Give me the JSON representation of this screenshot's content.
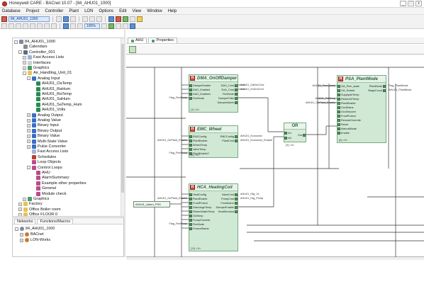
{
  "window": {
    "title": "Honeywell CARE - BACnet 10.07 - [84_AHU01_1000]",
    "controls": [
      "_",
      "□",
      "x"
    ]
  },
  "menu": [
    "Database",
    "Project",
    "Controller",
    "Plant",
    "LON",
    "Options",
    "Edit",
    "View",
    "Window",
    "Help"
  ],
  "toolbar": {
    "project_combo": "84_AHU01_1000",
    "zoom_combo": "100%"
  },
  "tree": {
    "nodes": [
      {
        "label": "84_AHU01_1000",
        "indent": 0,
        "toggle": "-",
        "icon": "building-icon"
      },
      {
        "label": "Calendars",
        "indent": 1,
        "toggle": "",
        "icon": "calendar-icon"
      },
      {
        "label": "Controller_001",
        "indent": 1,
        "toggle": "-",
        "icon": "controller-icon"
      },
      {
        "label": "Fast Access Lists",
        "indent": 2,
        "toggle": "+",
        "icon": "fast-access-icon"
      },
      {
        "label": "Interfaces",
        "indent": 2,
        "toggle": "+",
        "icon": "interface-icon"
      },
      {
        "label": "Graphics",
        "indent": 2,
        "toggle": "+",
        "icon": "graphics-icon"
      },
      {
        "label": "Air_Handling_Unit_01",
        "indent": 2,
        "toggle": "-",
        "icon": "folder-icon"
      },
      {
        "label": "Analog Input",
        "indent": 3,
        "toggle": "-",
        "icon": "point-icon"
      },
      {
        "label": "AHU01_OaTemp",
        "indent": 4,
        "toggle": "",
        "icon": "datapoint-icon"
      },
      {
        "label": "AHU01_RaHum",
        "indent": 4,
        "toggle": "",
        "icon": "datapoint-icon"
      },
      {
        "label": "AHU01_RaTemp",
        "indent": 4,
        "toggle": "",
        "icon": "datapoint-icon"
      },
      {
        "label": "AHU01_SaHum",
        "indent": 4,
        "toggle": "",
        "icon": "datapoint-icon"
      },
      {
        "label": "AHU01_SaTemp_Hum",
        "indent": 4,
        "toggle": "",
        "icon": "datapoint-icon"
      },
      {
        "label": "AHU01_Volts",
        "indent": 4,
        "toggle": "",
        "icon": "datapoint-icon"
      },
      {
        "label": "Analog Output",
        "indent": 3,
        "toggle": "+",
        "icon": "point-icon"
      },
      {
        "label": "Analog Value",
        "indent": 3,
        "toggle": "+",
        "icon": "point-icon"
      },
      {
        "label": "Binary Input",
        "indent": 3,
        "toggle": "+",
        "icon": "point-icon"
      },
      {
        "label": "Binary Output",
        "indent": 3,
        "toggle": "+",
        "icon": "point-icon"
      },
      {
        "label": "Binary Value",
        "indent": 3,
        "toggle": "+",
        "icon": "point-icon"
      },
      {
        "label": "Multi-State Value",
        "indent": 3,
        "toggle": "+",
        "icon": "point-icon"
      },
      {
        "label": "Pulse Converter",
        "indent": 3,
        "toggle": "+",
        "icon": "point-icon"
      },
      {
        "label": "Fast Access Lists",
        "indent": 3,
        "toggle": "",
        "icon": "fast-access-icon"
      },
      {
        "label": "Schedules",
        "indent": 3,
        "toggle": "",
        "icon": "schedule-icon"
      },
      {
        "label": "Loop Objects",
        "indent": 3,
        "toggle": "",
        "icon": "loop-icon"
      },
      {
        "label": "Control Loops",
        "indent": 3,
        "toggle": "-",
        "icon": "loop-icon"
      },
      {
        "label": "AHU",
        "indent": 4,
        "toggle": "",
        "icon": "loop-icon"
      },
      {
        "label": "AlarmSummary",
        "indent": 4,
        "toggle": "",
        "icon": "loop-icon"
      },
      {
        "label": "Example other properties",
        "indent": 4,
        "toggle": "",
        "icon": "loop-icon"
      },
      {
        "label": "General",
        "indent": 4,
        "toggle": "",
        "icon": "loop-icon"
      },
      {
        "label": "Module check",
        "indent": 4,
        "toggle": "",
        "icon": "loop-icon"
      },
      {
        "label": "Graphics",
        "indent": 2,
        "toggle": "+",
        "icon": "graphics-icon"
      },
      {
        "label": "Factory",
        "indent": 1,
        "toggle": "+",
        "icon": "folder-icon"
      },
      {
        "label": "Office Boiler room",
        "indent": 1,
        "toggle": "+",
        "icon": "folder-icon"
      },
      {
        "label": "Office FLOOR 0",
        "indent": 1,
        "toggle": "+",
        "icon": "folder-icon"
      }
    ]
  },
  "bottom_panel": {
    "tabs": [
      "Networks",
      "Functions/Macros"
    ],
    "nodes": [
      {
        "label": "84_AHU01_1000",
        "indent": 0,
        "toggle": "-"
      },
      {
        "label": "BACnet",
        "indent": 1,
        "toggle": "+"
      },
      {
        "label": "LON-Works",
        "indent": 1,
        "toggle": "+"
      }
    ]
  },
  "doc_tabs": [
    "AHU",
    "Properties"
  ],
  "blocks": [
    {
      "id": "dmx",
      "title": "DMA_OnOffDamper",
      "inputs": [
        "DamperEnable",
        "DAO_Enabled",
        "DAO_EnableIn",
        "FireMode"
      ],
      "outputs": [
        "DAO_Cmd",
        "EnD_Cmd",
        "FireMode",
        "DamperFdbk",
        "DamperAlarm"
      ],
      "in_labels": [
        "",
        "",
        "",
        "Flag_FireMode"
      ],
      "out_labels": [
        "AHU01_OaDmCmd",
        "AHU01_ExDmCmd",
        "",
        "",
        ""
      ],
      "footer": "[1] <0>"
    },
    {
      "id": "emc",
      "title": "EMC_Wheel",
      "inputs": [
        "EMCConfig",
        "PlantEnable",
        "WheelTemp",
        "ValveTemp",
        "PlantEnable2"
      ],
      "outputs": [
        "EMCConfig",
        "PlantCmd"
      ],
      "in_labels": [
        "",
        "AHU01_OnPlant_Enable",
        "",
        "",
        "Flag_FireMode"
      ],
      "out_labels": [
        "AHU01_Economiz",
        "AHU01_Economiz_Enable"
      ],
      "footer": "[1] <0>"
    },
    {
      "id": "hca",
      "title": "HCA_HeatingCoil",
      "inputs": [
        "HeatConfig",
        "PlantEnable",
        "FrostProtect",
        "DischargeTemp",
        "ReturnWaterTemp",
        "OATemp",
        "PumpOverride",
        "FireMode",
        "FreezeStatus"
      ],
      "outputs": [
        "ValveCmd",
        "PumpCmd",
        "FrostAlarm",
        "DamperEnable",
        "HeatDemand"
      ],
      "in_labels": [
        "",
        "AHU01_OnPlant_Enable",
        "",
        "",
        "",
        "",
        "",
        "Flag_FireMode",
        ""
      ],
      "out_labels": [
        "AHU01_Htg_VL",
        "AHU01_Htg_Pump",
        "",
        "",
        ""
      ],
      "footer": "[11] <0>"
    },
    {
      "id": "psa",
      "title": "PSA_PlantMode",
      "inputs": [
        "OA_Pem_state",
        "OA_Enable",
        "SupplyAirTemp",
        "ReturnAirTemp",
        "PlantEnable",
        "OccStatus",
        "OccSetpoint",
        "FrostProtect",
        "RemoteOverride",
        "Reset",
        "ManualMode",
        "Enable"
      ],
      "outputs": [
        "PlantMode",
        "StageCount"
      ],
      "in_labels": [
        "AHU01_Pem_state",
        "",
        "",
        "AHU01_RaTemp",
        "AHU01_OnPlant_Enable",
        "",
        "",
        "",
        "",
        "",
        "",
        ""
      ],
      "out_labels": [
        "Flag_PlantMode",
        "AHU01_PlantMode"
      ],
      "footer": "[6] <0>"
    }
  ],
  "or_gate": {
    "title": "OR",
    "inputs": [
      "In1",
      "In2"
    ],
    "output": "Out",
    "footer": "[3] <0>"
  },
  "const_box": {
    "label": "AHU01_Alarm_PSS"
  }
}
